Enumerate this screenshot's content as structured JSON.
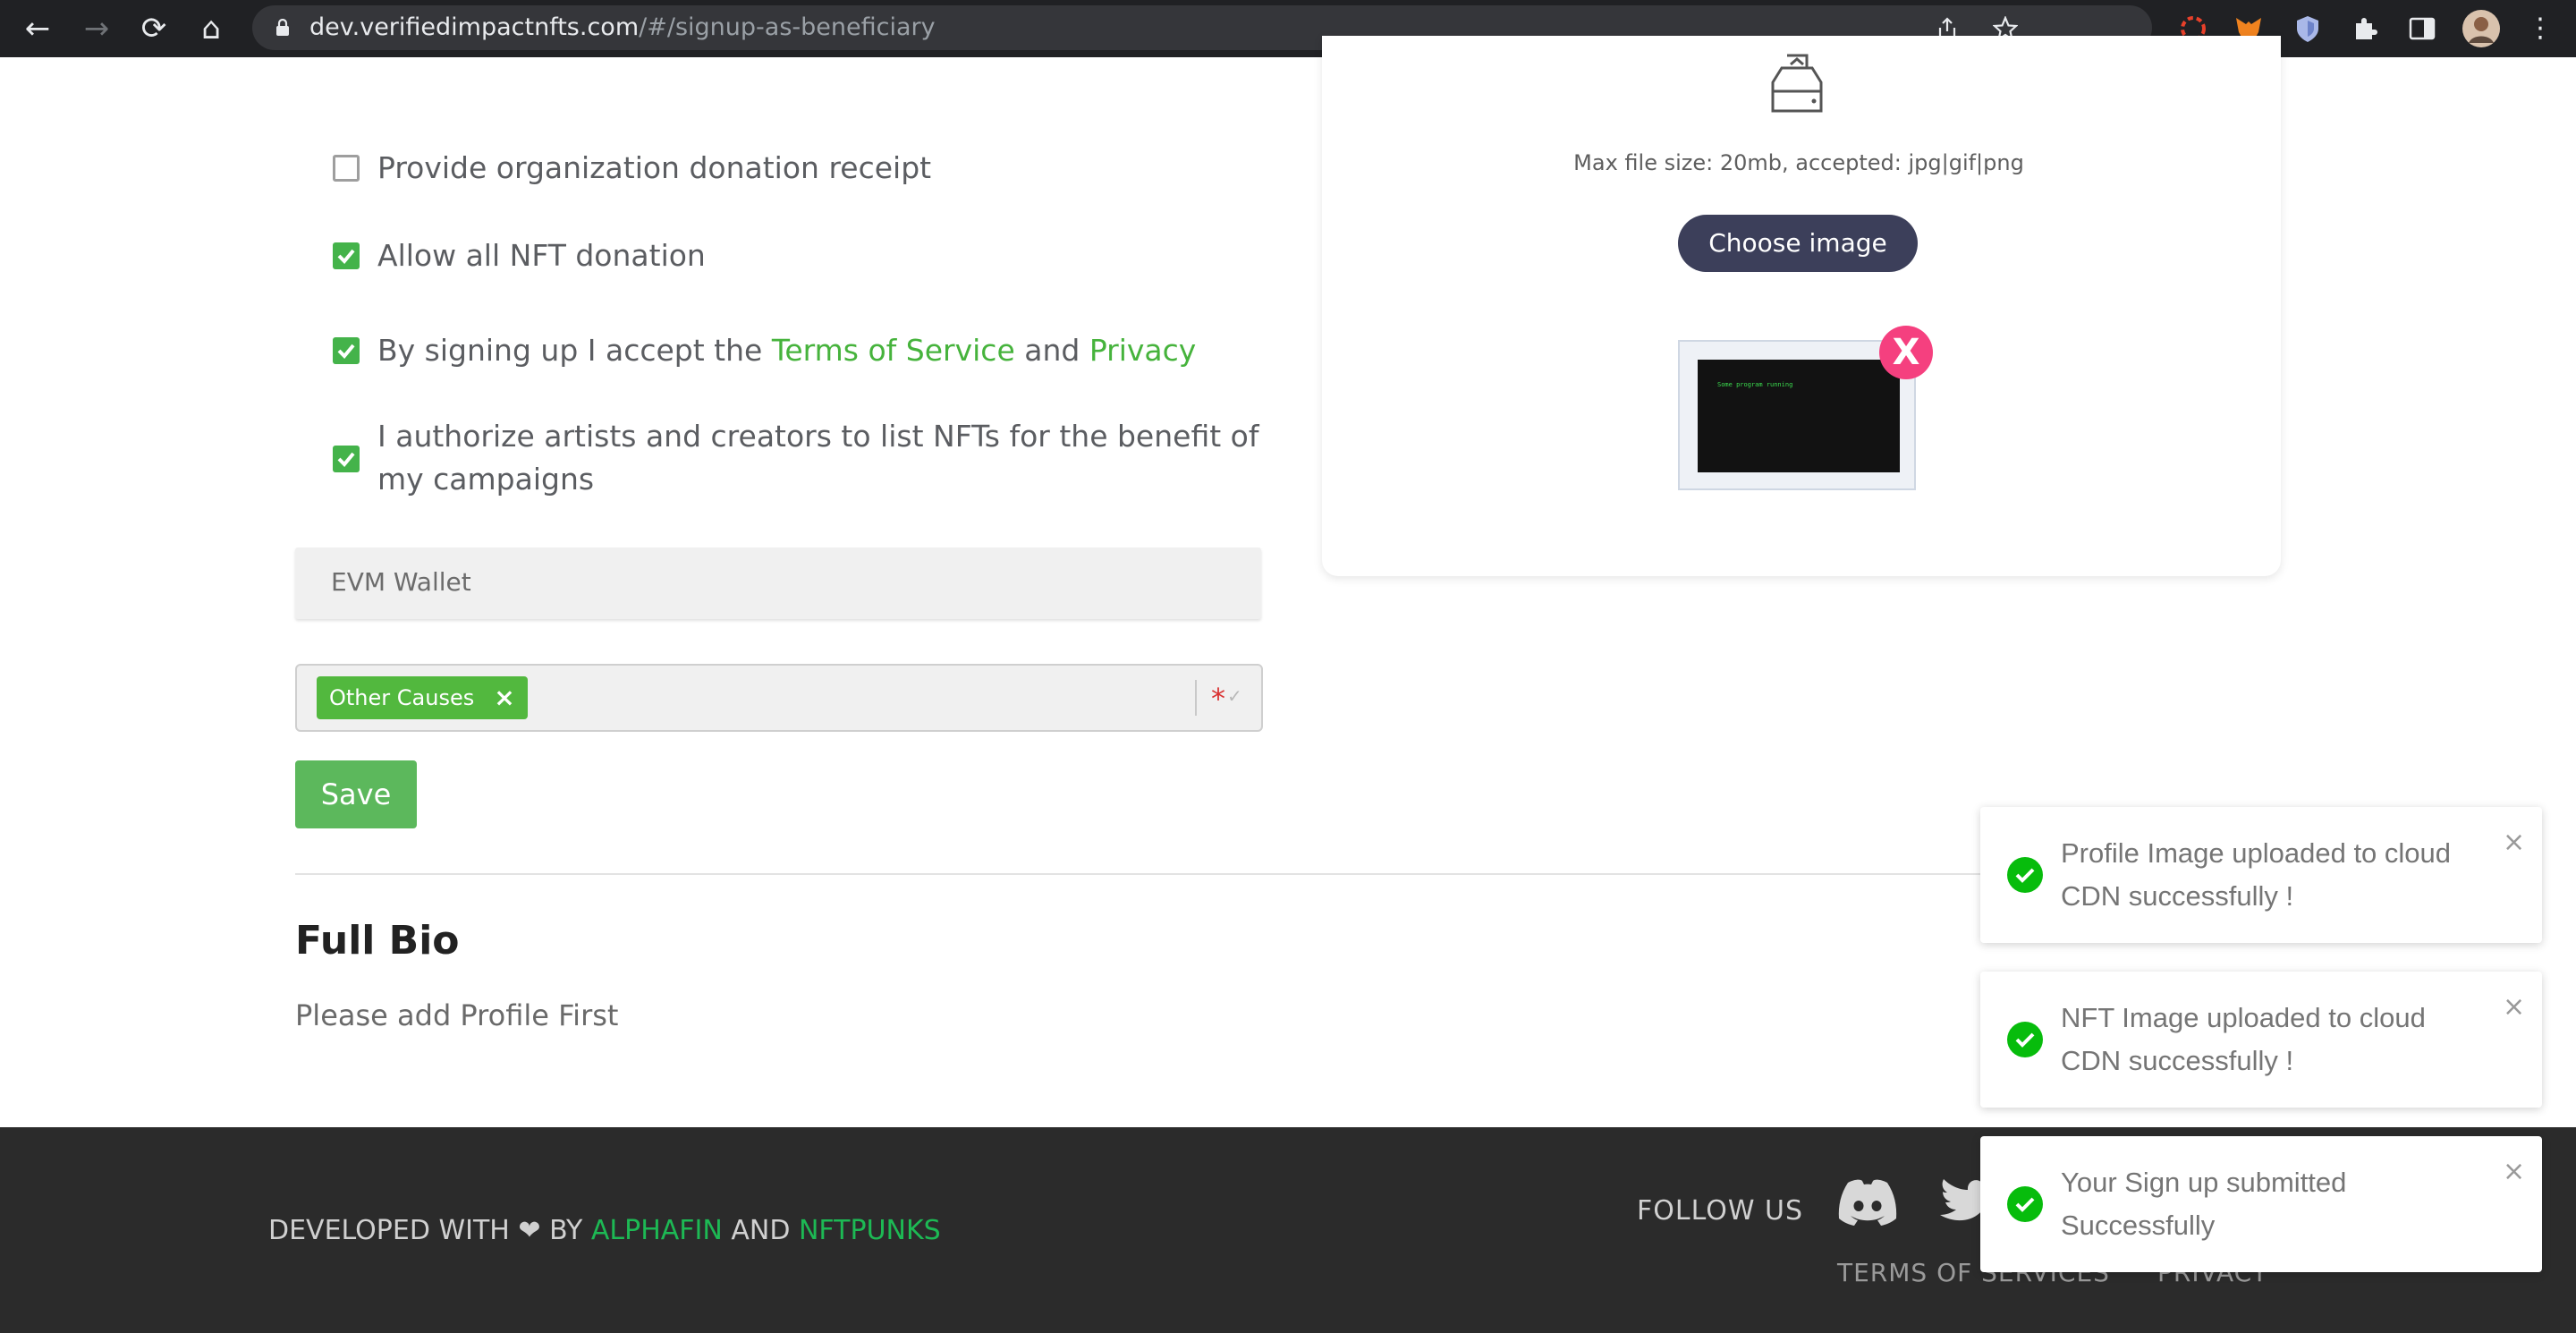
{
  "browser": {
    "url_host": "dev.verifiedimpactnfts.com",
    "url_path": "/#/signup-as-beneficiary"
  },
  "form": {
    "checkboxes": [
      {
        "label": "Provide organization donation receipt",
        "checked": false
      },
      {
        "label": "Allow all NFT donation",
        "checked": true
      },
      {
        "label_prefix": "By signing up I accept the ",
        "terms_link": "Terms of Service",
        "and": " and ",
        "privacy_link": "Privacy",
        "checked": true
      },
      {
        "label": "I authorize artists and creators to list NFTs for the benefit of my campaigns",
        "checked": true
      }
    ],
    "wallet_placeholder": "EVM Wallet",
    "cause_tag": "Other Causes",
    "cause_tag_remove": "×",
    "required_marker": "*",
    "save_label": "Save"
  },
  "upload": {
    "hint": "Max file size: 20mb, accepted: jpg|gif|png",
    "choose_label": "Choose image",
    "remove_label": "X",
    "preview_text": "Some program running"
  },
  "bio": {
    "title": "Full Bio",
    "text": "Please add Profile First"
  },
  "footer": {
    "developed_prefix": "DEVELOPED WITH ❤ BY ",
    "alphafin": "ALPHAFIN",
    "and": " AND ",
    "nftpunks": "NFTPUNKS",
    "follow_us": "FOLLOW US",
    "terms": "TERMS OF SERVICES",
    "privacy": "PRIVACY"
  },
  "toasts": [
    {
      "message": "Profile Image uploaded to cloud CDN successfully !",
      "close": "×"
    },
    {
      "message": "NFT Image uploaded to cloud CDN successfully !",
      "close": "×"
    },
    {
      "message": "Your Sign up submitted Successfully",
      "close": "×"
    }
  ],
  "colors": {
    "accent_green": "#46b33c",
    "toast_success": "#07bc0c",
    "remove_pink": "#f5407f",
    "button_dark": "#3c3f5a"
  }
}
